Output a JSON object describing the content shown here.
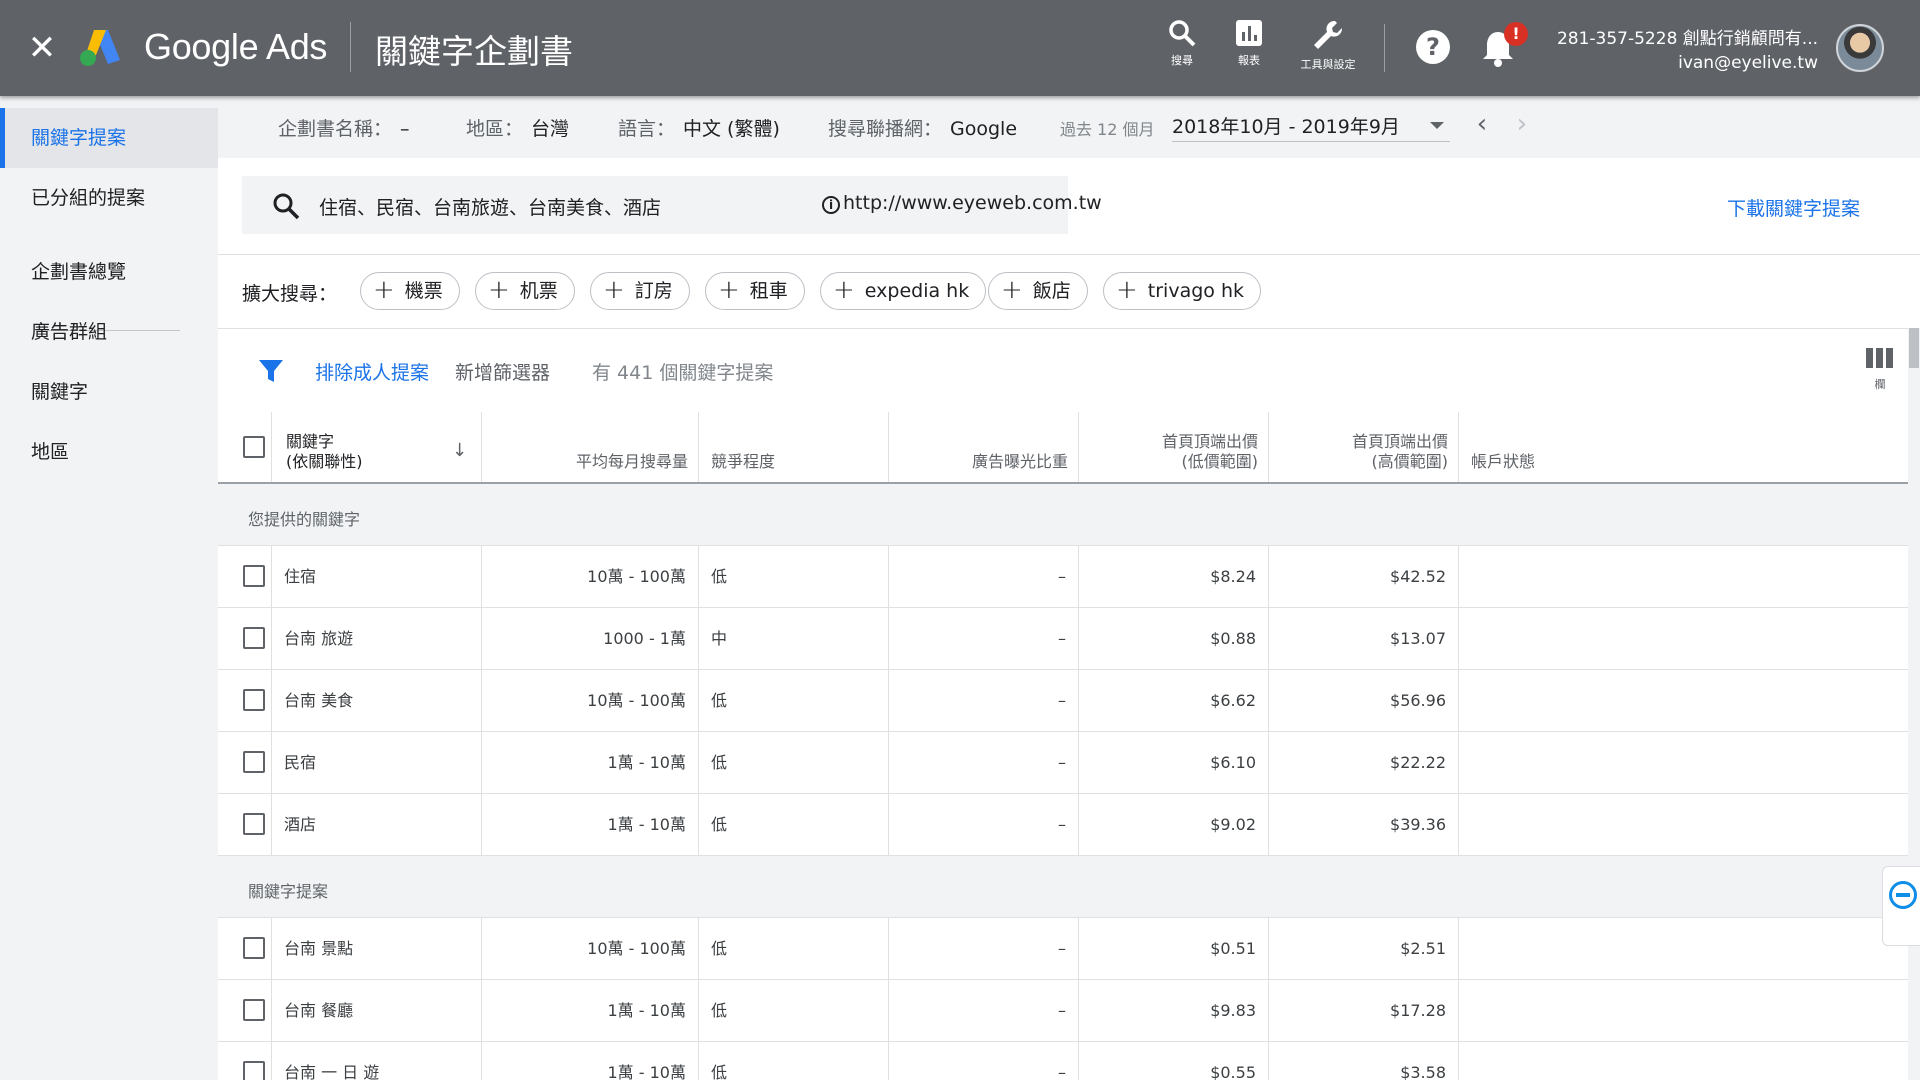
{
  "header": {
    "brand": "Google Ads",
    "page_title": "關鍵字企劃書",
    "tools": [
      {
        "icon": "search-icon",
        "label": "搜尋"
      },
      {
        "icon": "reports-icon",
        "label": "報表"
      },
      {
        "icon": "wrench-icon",
        "label": "工具與設定"
      }
    ],
    "help_icon": "question-icon",
    "notification_badge": "!",
    "account_line1": "281-357-5228 創點行銷顧問有...",
    "account_line2": "ivan@eyelive.tw",
    "colors": {
      "bar": "#5f6368",
      "badge": "#d93025"
    }
  },
  "sidebar": {
    "items": [
      {
        "label": "關鍵字提案",
        "active": true
      },
      {
        "label": "已分組的提案",
        "active": false
      },
      {
        "label": "企劃書總覽",
        "active": false
      },
      {
        "label": "廣告群組",
        "active": false
      },
      {
        "label": "關鍵字",
        "active": false
      },
      {
        "label": "地區",
        "active": false
      }
    ],
    "accent": "#1a73e8"
  },
  "plan_info": {
    "name_label": "企劃書名稱：",
    "name_value": "–",
    "location_label": "地區：",
    "location_value": "台灣",
    "language_label": "語言：",
    "language_value": "中文 (繁體)",
    "network_label": "搜尋聯播網：",
    "network_value": "Google",
    "range_label": "過去 12 個月",
    "range_value": "2018年10月 - 2019年9月"
  },
  "search": {
    "keywords": "住宿、民宿、台南旅遊、台南美食、酒店",
    "url": "http://www.eyeweb.com.tw",
    "download_label": "下載關鍵字提案"
  },
  "broaden": {
    "label": "擴大搜尋：",
    "chips": [
      "機票",
      "机票",
      "訂房",
      "租車",
      "expedia hk",
      "飯店",
      "trivago hk"
    ]
  },
  "filters": {
    "exclude_adult": "排除成人提案",
    "add_filter": "新增篩選器",
    "count_text": "有 441 個關鍵字提案",
    "columns_label": "欄"
  },
  "table": {
    "headers": {
      "keyword_line1": "關鍵字",
      "keyword_line2": "(依關聯性)",
      "avg_searches": "平均每月搜尋量",
      "competition": "競爭程度",
      "impression_share": "廣告曝光比重",
      "bid_low_line1": "首頁頂端出價",
      "bid_low_line2": "(低價範圍)",
      "bid_high_line1": "首頁頂端出價",
      "bid_high_line2": "(高價範圍)",
      "account_status": "帳戶狀態"
    },
    "section_provided": "您提供的關鍵字",
    "section_ideas": "關鍵字提案",
    "provided_rows": [
      {
        "keyword": "住宿",
        "volume": "10萬 - 100萬",
        "competition": "低",
        "share": "–",
        "bid_low": "$8.24",
        "bid_high": "$42.52"
      },
      {
        "keyword": "台南 旅遊",
        "volume": "1000 - 1萬",
        "competition": "中",
        "share": "–",
        "bid_low": "$0.88",
        "bid_high": "$13.07"
      },
      {
        "keyword": "台南 美食",
        "volume": "10萬 - 100萬",
        "competition": "低",
        "share": "–",
        "bid_low": "$6.62",
        "bid_high": "$56.96"
      },
      {
        "keyword": "民宿",
        "volume": "1萬 - 10萬",
        "competition": "低",
        "share": "–",
        "bid_low": "$6.10",
        "bid_high": "$22.22"
      },
      {
        "keyword": "酒店",
        "volume": "1萬 - 10萬",
        "competition": "低",
        "share": "–",
        "bid_low": "$9.02",
        "bid_high": "$39.36"
      }
    ],
    "idea_rows": [
      {
        "keyword": "台南 景點",
        "volume": "10萬 - 100萬",
        "competition": "低",
        "share": "–",
        "bid_low": "$0.51",
        "bid_high": "$2.51"
      },
      {
        "keyword": "台南 餐廳",
        "volume": "1萬 - 10萬",
        "competition": "低",
        "share": "–",
        "bid_low": "$9.83",
        "bid_high": "$17.28"
      },
      {
        "keyword": "台南 一 日 遊",
        "volume": "1萬 - 10萬",
        "competition": "低",
        "share": "–",
        "bid_low": "$0.55",
        "bid_high": "$3.58"
      }
    ]
  }
}
